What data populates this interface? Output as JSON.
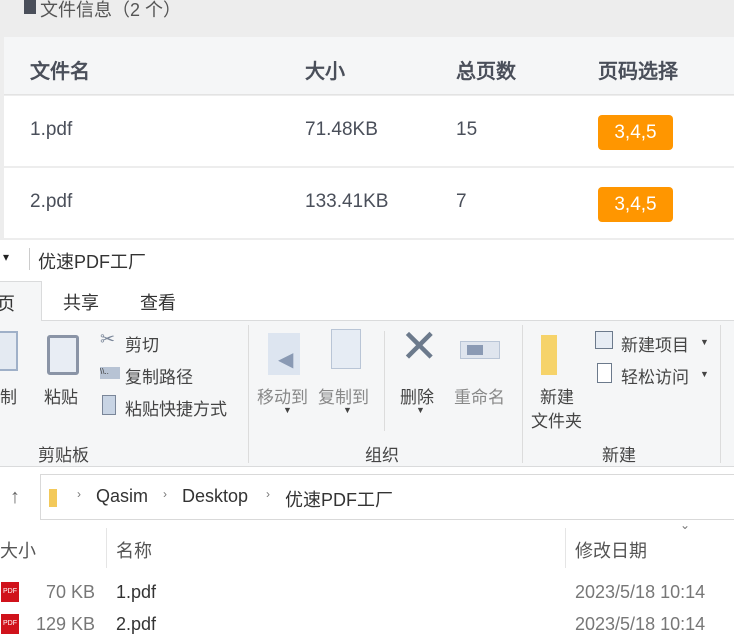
{
  "file_info": {
    "title": "文件信息（2 个）",
    "columns": [
      "文件名",
      "大小",
      "总页数",
      "页码选择"
    ],
    "rows": [
      {
        "name": "1.pdf",
        "size": "71.48KB",
        "pages": "15",
        "selection": "3,4,5"
      },
      {
        "name": "2.pdf",
        "size": "133.41KB",
        "pages": "7",
        "selection": "3,4,5"
      }
    ],
    "badge_color": "#ff9600"
  },
  "explorer": {
    "window_title": "优速PDF工厂",
    "tabs": [
      "主页",
      "共享",
      "查看"
    ],
    "clipboard": {
      "copy": "复制",
      "paste": "粘贴",
      "cut": "剪切",
      "copy_path": "复制路径",
      "paste_shortcut": "粘贴快捷方式",
      "group": "剪贴板"
    },
    "organize": {
      "move_to": "移动到",
      "copy_to": "复制到",
      "delete": "删除",
      "rename": "重命名",
      "group": "组织"
    },
    "new": {
      "new_folder_1": "新建",
      "new_folder_2": "文件夹",
      "new_item": "新建项目",
      "easy_access": "轻松访问",
      "group": "新建"
    },
    "breadcrumb": [
      "Qasim",
      "Desktop",
      "优速PDF工厂"
    ],
    "columns": {
      "size": "大小",
      "name": "名称",
      "modified": "修改日期"
    },
    "files": [
      {
        "size": "70 KB",
        "name": "1.pdf",
        "modified": "2023/5/18 10:14"
      },
      {
        "size": "129 KB",
        "name": "2.pdf",
        "modified": "2023/5/18 10:14"
      }
    ]
  }
}
